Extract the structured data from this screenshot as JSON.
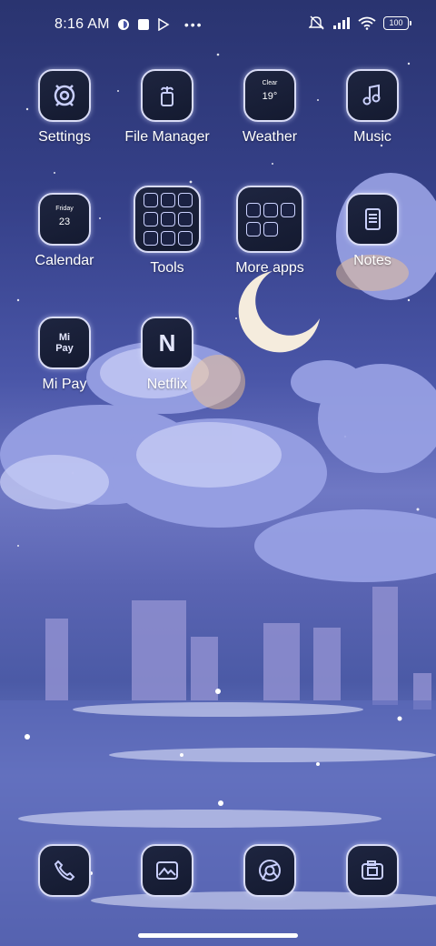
{
  "status": {
    "time": "8:16 AM",
    "notification_icons": [
      "circle-icon",
      "square-icon",
      "play-store-icon"
    ],
    "more_dots": "•••",
    "battery": "100"
  },
  "home": {
    "apps": [
      {
        "label": "Settings",
        "icon": "settings-icon"
      },
      {
        "label": "File Manager",
        "icon": "file-manager-icon"
      },
      {
        "label": "Weather",
        "icon": "weather-icon",
        "weather": {
          "condition": "Clear",
          "temp": "19°"
        }
      },
      {
        "label": "Music",
        "icon": "music-note-icon"
      },
      {
        "label": "Calendar",
        "icon": "calendar-icon",
        "calendar": {
          "day": "Friday",
          "date": "23"
        }
      },
      {
        "label": "Tools",
        "icon": "folder-icon"
      },
      {
        "label": "More apps",
        "icon": "folder-icon"
      },
      {
        "label": "Notes",
        "icon": "notes-icon"
      },
      {
        "label": "Mi Pay",
        "icon": "mi-pay-icon",
        "icon_text": "Mi\nPay"
      },
      {
        "label": "Netflix",
        "icon": "netflix-icon",
        "icon_text": "N"
      }
    ]
  },
  "dock": [
    {
      "icon": "phone-icon"
    },
    {
      "icon": "gallery-icon"
    },
    {
      "icon": "chrome-icon"
    },
    {
      "icon": "camera-icon"
    }
  ],
  "colors": {
    "icon_bg": "#161c34",
    "icon_border": "#d9dcf6",
    "accent": "#c9cffc"
  }
}
